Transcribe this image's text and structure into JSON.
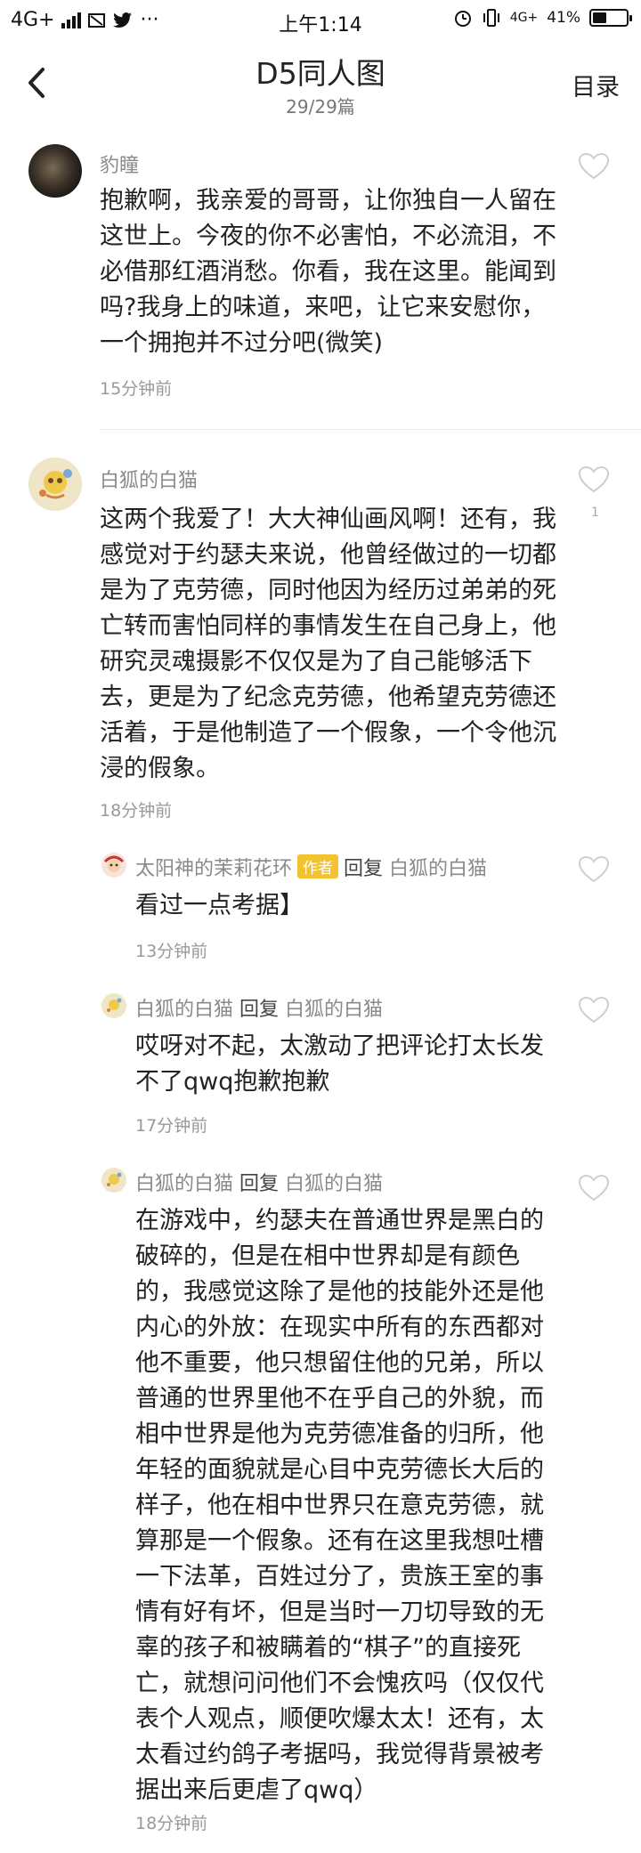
{
  "status_bar": {
    "network": "4G+",
    "time": "上午1:14",
    "net_type": "4G+",
    "battery": "41%",
    "battery_level": 0.41,
    "icons": [
      "signal-icon",
      "notification-icon",
      "twitter-icon",
      "more-icon",
      "alarm-icon",
      "vibrate-icon",
      "battery-icon"
    ]
  },
  "nav": {
    "title": "D5同人图",
    "subtitle": "29/29篇",
    "toc_label": "目录"
  },
  "comments": [
    {
      "user": "豹瞳",
      "text": "抱歉啊，我亲爱的哥哥，让你独自一人留在这世上。今夜的你不必害怕，不必流泪，不必借那红酒消愁。你看，我在这里。能闻到吗?我身上的味道，来吧，让它来安慰你，一个拥抱并不过分吧(微笑)",
      "time": "15分钟前"
    },
    {
      "user": "白狐的白猫",
      "text": "这两个我爱了！大大神仙画风啊！还有，我感觉对于约瑟夫来说，他曾经做过的一切都是为了克劳德，同时他因为经历过弟弟的死亡转而害怕同样的事情发生在自己身上，他研究灵魂摄影不仅仅是为了自己能够活下去，更是为了纪念克劳德，他希望克劳德还活着，于是他制造了一个假象，一个令他沉浸的假象。",
      "time": "18分钟前",
      "likes": "1"
    }
  ],
  "replies": [
    {
      "user": "太阳神的茉莉花环",
      "badge": "作者",
      "reply_word": "回复",
      "target": "白狐的白猫",
      "text": "看过一点考据】",
      "time": "13分钟前"
    },
    {
      "user": "白狐的白猫",
      "reply_word": "回复",
      "target": "白狐的白猫",
      "text": "哎呀对不起，太激动了把评论打太长发不了qwq抱歉抱歉",
      "time": "17分钟前"
    },
    {
      "user": "白狐的白猫",
      "reply_word": "回复",
      "target": "白狐的白猫",
      "text": "在游戏中，约瑟夫在普通世界是黑白的破碎的，但是在相中世界却是有颜色的，我感觉这除了是他的技能外还是他内心的外放：在现实中所有的东西都对他不重要，他只想留住他的兄弟，所以普通的世界里他不在乎自己的外貌，而相中世界是他为克劳德准备的归所，他年轻的面貌就是心目中克劳德长大后的样子，他在相中世界只在意克劳德，就算那是一个假象。还有在这里我想吐槽一下法革，百姓过分了，贵族王室的事情有好有坏，但是当时一刀切导致的无辜的孩子和被瞒着的“棋子”的直接死亡，就想问问他们不会愧疚吗（仅仅代表个人观点，顺便吹爆太太！还有，太太看过约鸽子考据吗，我觉得背景被考据出来后更虐了qwq）",
      "time": "18分钟前"
    }
  ]
}
